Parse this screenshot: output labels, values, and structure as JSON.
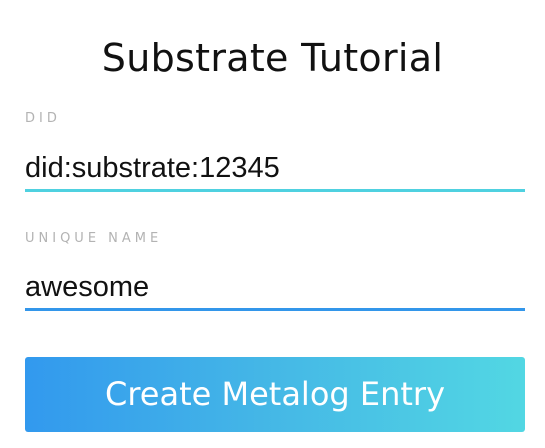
{
  "page": {
    "title": "Substrate Tutorial"
  },
  "form": {
    "did": {
      "label": "DID",
      "value": "did:substrate:12345"
    },
    "unique_name": {
      "label": "UNIQUE NAME",
      "value": "awesome"
    },
    "submit_label": "Create Metalog Entry"
  },
  "colors": {
    "underline_did": "#4fd1e0",
    "underline_name": "#3396ea",
    "button_gradient_start": "#3299ee",
    "button_gradient_end": "#52d7e3",
    "label_text": "#b3b3b3"
  }
}
